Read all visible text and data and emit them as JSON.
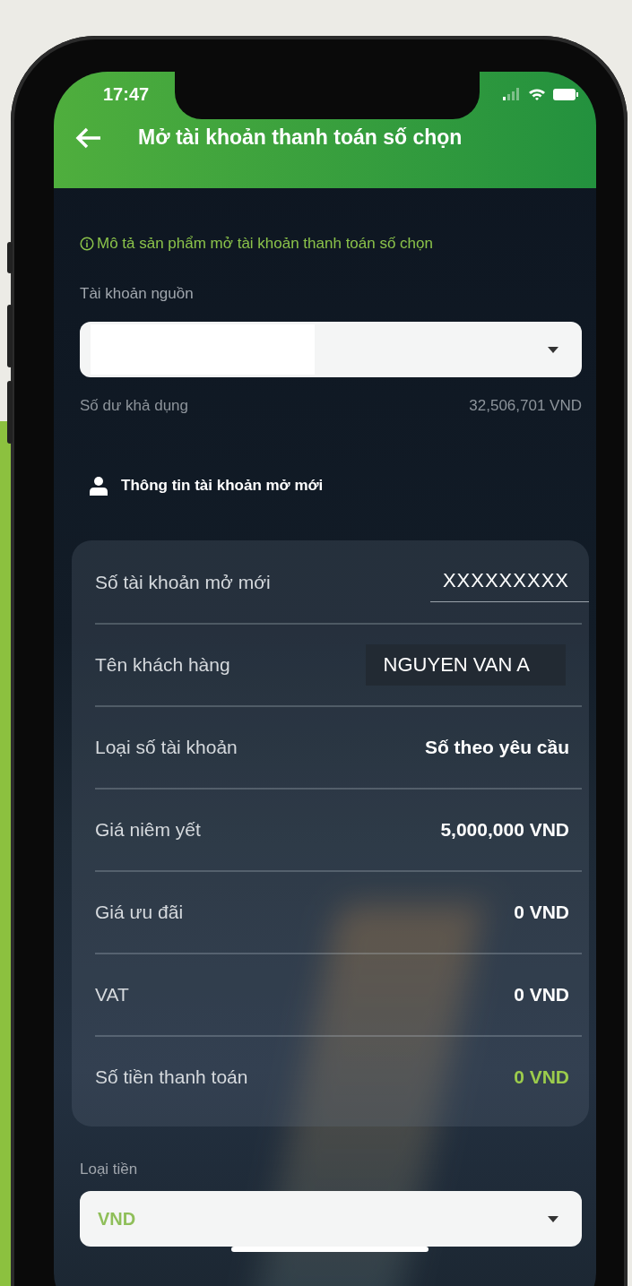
{
  "status_bar": {
    "time": "17:47"
  },
  "header": {
    "title": "Mở tài khoản thanh toán số chọn"
  },
  "info_link": "Mô tả sản phẩm mở tài khoản thanh toán số chọn",
  "source_account": {
    "label": "Tài khoản nguồn"
  },
  "balance": {
    "label": "Số dư khả dụng",
    "value": "32,506,701 VND"
  },
  "section": {
    "title": "Thông tin tài khoản mở mới"
  },
  "details": [
    {
      "label": "Số tài khoản mở mới",
      "value": "XXXXXXXXX",
      "kind": "underlined"
    },
    {
      "label": "Tên khách hàng",
      "value": "NGUYEN VAN A",
      "kind": "boxed"
    },
    {
      "label": "Loại số tài khoản",
      "value": "Số theo yêu cầu",
      "kind": "plain"
    },
    {
      "label": "Giá niêm yết",
      "value": "5,000,000 VND",
      "kind": "plain"
    },
    {
      "label": "Giá ưu đãi",
      "value": "0 VND",
      "kind": "plain"
    },
    {
      "label": "VAT",
      "value": "0 VND",
      "kind": "plain"
    },
    {
      "label": "Số tiền thanh toán",
      "value": "0 VND",
      "kind": "accent"
    }
  ],
  "currency": {
    "label": "Loại tiền",
    "value": "VND"
  }
}
